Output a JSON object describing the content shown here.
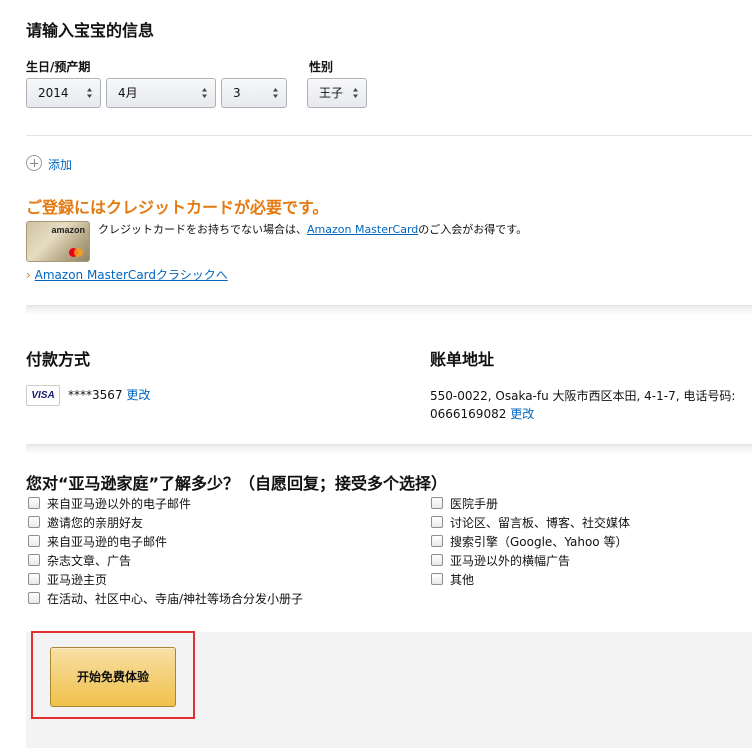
{
  "baby_info": {
    "title": "请输入宝宝的信息",
    "birthday_label": "生日/预产期",
    "year_value": "2014",
    "month_value": "4月",
    "day_value": "3",
    "gender_label": "性别",
    "gender_value": "王子",
    "add_label": "添加"
  },
  "promo": {
    "heading": "ご登録にはクレジットカードが必要です。",
    "card_brand": "amazon",
    "text_before": "クレジットカードをお持ちでない場合は、",
    "link_text": "Amazon MasterCard",
    "text_after": "のご入会がお得です。",
    "classic_link_prefix": "›",
    "classic_link": "Amazon MasterCardクラシックへ"
  },
  "payment": {
    "title": "付款方式",
    "card_badge": "VISA",
    "card_number": "****3567",
    "change_label": "更改"
  },
  "billing": {
    "title": "账单地址",
    "address_line1": "550-0022, Osaka-fu 大阪市西区本田, 4-1-7, 电话号码:",
    "address_line2": "0666169082",
    "change_label": "更改"
  },
  "survey": {
    "question": "您对“亚马逊家庭”了解多少？（自愿回复；接受多个选择）",
    "left_options": [
      "来自亚马逊以外的电子邮件",
      "邀请您的亲朋好友",
      "来自亚马逊的电子邮件",
      "杂志文章、广告",
      "亚马逊主页",
      "在活动、社区中心、寺庙/神社等场合分发小册子"
    ],
    "right_options": [
      "医院手册",
      "讨论区、留言板、博客、社交媒体",
      "搜索引擎（Google、Yahoo 等）",
      "亚马逊以外的横幅广告",
      "其他"
    ]
  },
  "cta": {
    "label": "开始免费体验"
  },
  "colors": {
    "promo_orange": "#e47911",
    "link_blue": "#0066c0",
    "button_yellow": "#f0c14b",
    "highlight_red": "#e03030"
  }
}
